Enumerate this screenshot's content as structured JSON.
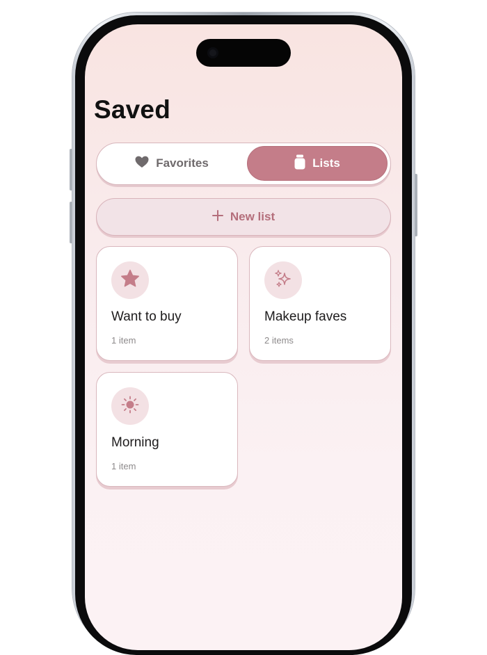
{
  "screen": {
    "title": "Saved"
  },
  "segmented": {
    "favorites_label": "Favorites",
    "lists_label": "Lists",
    "selected": "Lists"
  },
  "new_list": {
    "label": "New list"
  },
  "lists": [
    {
      "title": "Want to buy",
      "count": "1 item",
      "icon": "star-icon"
    },
    {
      "title": "Makeup faves",
      "count": "2 items",
      "icon": "sparkle-icon"
    },
    {
      "title": "Morning",
      "count": "1 item",
      "icon": "sun-icon"
    }
  ],
  "colors": {
    "accent": "#c47d89",
    "accent_text": "#b46e7b",
    "card_icon_bg": "#f3e1e4",
    "background_top": "#f9e4e1",
    "background_bottom": "#fcf2f4"
  }
}
